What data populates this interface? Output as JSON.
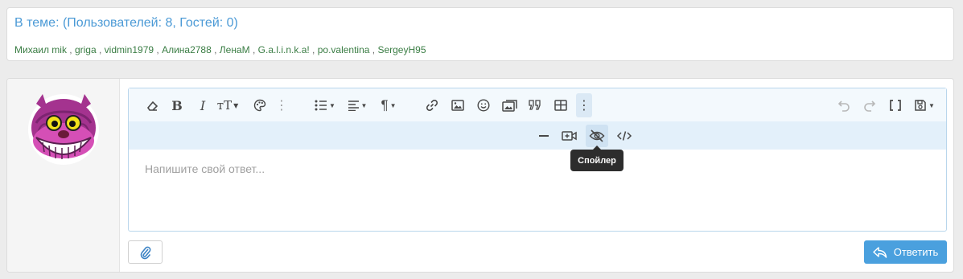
{
  "members": {
    "title": "В теме: (Пользователей: 8, Гостей: 0)",
    "users": [
      "Михаил mik",
      "griga",
      "vidmin1979",
      "Алина2788",
      "ЛенаМ",
      "G.a.l.i.n.k.a!",
      "po.valentina",
      "SergeyH95"
    ],
    "separator": " , "
  },
  "editor": {
    "placeholder": "Напишите свой ответ...",
    "tooltip": "Спойлер",
    "toolbar_row1": [
      {
        "name": "clear-format-icon",
        "label": "⌫"
      },
      {
        "name": "bold-button",
        "label": "B"
      },
      {
        "name": "italic-button",
        "label": "I"
      },
      {
        "name": "text-size-button",
        "label": "тТ"
      },
      {
        "name": "color-palette-icon",
        "label": ""
      },
      {
        "name": "more-options-icon",
        "label": "⋮"
      },
      {
        "name": "list-button",
        "label": ""
      },
      {
        "name": "align-button",
        "label": ""
      },
      {
        "name": "paragraph-button",
        "label": "¶"
      },
      {
        "name": "link-icon",
        "label": ""
      },
      {
        "name": "image-icon",
        "label": ""
      },
      {
        "name": "emoji-icon",
        "label": ""
      },
      {
        "name": "media-gallery-icon",
        "label": ""
      },
      {
        "name": "quote-icon",
        "label": ""
      },
      {
        "name": "table-icon",
        "label": ""
      },
      {
        "name": "more-vertical-icon",
        "label": "⋮"
      }
    ]
  },
  "buttons": {
    "reply_label": "Ответить"
  },
  "colors": {
    "accent": "#4aa0de",
    "link": "#4b9ad6",
    "username": "#3a7d44"
  }
}
